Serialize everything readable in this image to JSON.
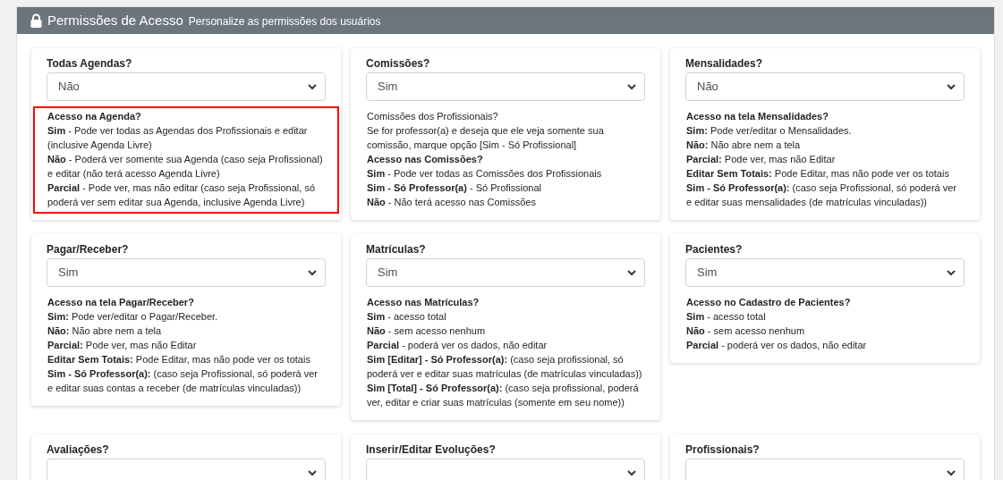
{
  "panel": {
    "title": "Permissões de Acesso",
    "subtitle": "Personalize as permissões dos usuários"
  },
  "cards": [
    {
      "label": "Todas Agendas?",
      "value": "Não",
      "highlighted": true,
      "lines": [
        {
          "kind": "heading",
          "text": "Acesso na Agenda?"
        },
        {
          "kind": "line",
          "text": "**Sim** - Pode ver todas as Agendas dos Profissionais e editar (inclusive Agenda Livre)"
        },
        {
          "kind": "line",
          "text": "**Não** - Poderá ver somente sua Agenda (caso seja Profissional) e editar (não terá acesso Agenda Livre)"
        },
        {
          "kind": "line",
          "text": "**Parcial** - Pode ver, mas não editar (caso seja Profissional, só poderá ver sem editar sua Agenda, inclusive Agenda Livre)"
        }
      ]
    },
    {
      "label": "Comissões?",
      "value": "Sim",
      "highlighted": false,
      "lines": [
        {
          "kind": "line",
          "text": "Comissões dos Profissionais?"
        },
        {
          "kind": "line",
          "text": "Se for professor(a) e deseja que ele veja somente sua comissão, marque opção [Sim - Só Profissional]"
        },
        {
          "kind": "heading",
          "text": "Acesso nas Comissões?"
        },
        {
          "kind": "line",
          "text": "**Sim** - Pode ver todas as Comissões dos Profissionais"
        },
        {
          "kind": "line",
          "text": "**Sim - Só Professor(a)** - Só Profissional"
        },
        {
          "kind": "line",
          "text": "**Não** - Não terá acesso nas Comissões"
        }
      ]
    },
    {
      "label": "Mensalidades?",
      "value": "Não",
      "highlighted": false,
      "lines": [
        {
          "kind": "heading",
          "text": "Acesso na tela Mensalidades?"
        },
        {
          "kind": "line",
          "text": "**Sim:** Pode ver/editar o Mensalidades."
        },
        {
          "kind": "line",
          "text": "**Não:** Não abre nem a tela"
        },
        {
          "kind": "line",
          "text": "**Parcial:** Pode ver, mas não Editar"
        },
        {
          "kind": "line",
          "text": "**Editar Sem Totais:** Pode Editar, mas não pode ver os totais"
        },
        {
          "kind": "line",
          "text": "**Sim - Só Professor(a):** (caso seja Profissional, só poderá ver e editar suas mensalidades (de matrículas vinculadas))"
        }
      ]
    },
    {
      "label": "Pagar/Receber?",
      "value": "Sim",
      "highlighted": false,
      "lines": [
        {
          "kind": "heading",
          "text": "Acesso na tela Pagar/Receber?"
        },
        {
          "kind": "line",
          "text": "**Sim:** Pode ver/editar o Pagar/Receber."
        },
        {
          "kind": "line",
          "text": "**Não:** Não abre nem a tela"
        },
        {
          "kind": "line",
          "text": "**Parcial:** Pode ver, mas não Editar"
        },
        {
          "kind": "line",
          "text": "**Editar Sem Totais:** Pode Editar, mas não pode ver os totais"
        },
        {
          "kind": "line",
          "text": "**Sim - Só Professor(a):** (caso seja Profissional, só poderá ver e editar suas contas a receber (de matrículas vinculadas))"
        }
      ]
    },
    {
      "label": "Matrículas?",
      "value": "Sim",
      "highlighted": false,
      "lines": [
        {
          "kind": "heading",
          "text": "Acesso nas Matrículas?"
        },
        {
          "kind": "line",
          "text": "**Sim** - acesso total"
        },
        {
          "kind": "line",
          "text": "**Não** - sem acesso nenhum"
        },
        {
          "kind": "line",
          "text": "**Parcial** - poderá ver os dados, não editar"
        },
        {
          "kind": "line",
          "text": "**Sim [Editar] - Só Professor(a):** (caso seja profissional, só poderá ver e editar suas matrículas (de matrículas vinculadas))"
        },
        {
          "kind": "line",
          "text": "**Sim [Total] - Só Professor(a):** (caso seja profissional, poderá ver, editar e criar suas matrículas (somente em seu nome))"
        }
      ]
    },
    {
      "label": "Pacientes?",
      "value": "Sim",
      "highlighted": false,
      "lines": [
        {
          "kind": "heading",
          "text": "Acesso no Cadastro de Pacientes?"
        },
        {
          "kind": "line",
          "text": "**Sim** - acesso total"
        },
        {
          "kind": "line",
          "text": "**Não** - sem acesso nenhum"
        },
        {
          "kind": "line",
          "text": "**Parcial** - poderá ver os dados, não editar"
        }
      ]
    },
    {
      "label": "Avaliações?"
    },
    {
      "label": "Inserir/Editar Evoluções?"
    },
    {
      "label": "Profissionais?"
    }
  ]
}
